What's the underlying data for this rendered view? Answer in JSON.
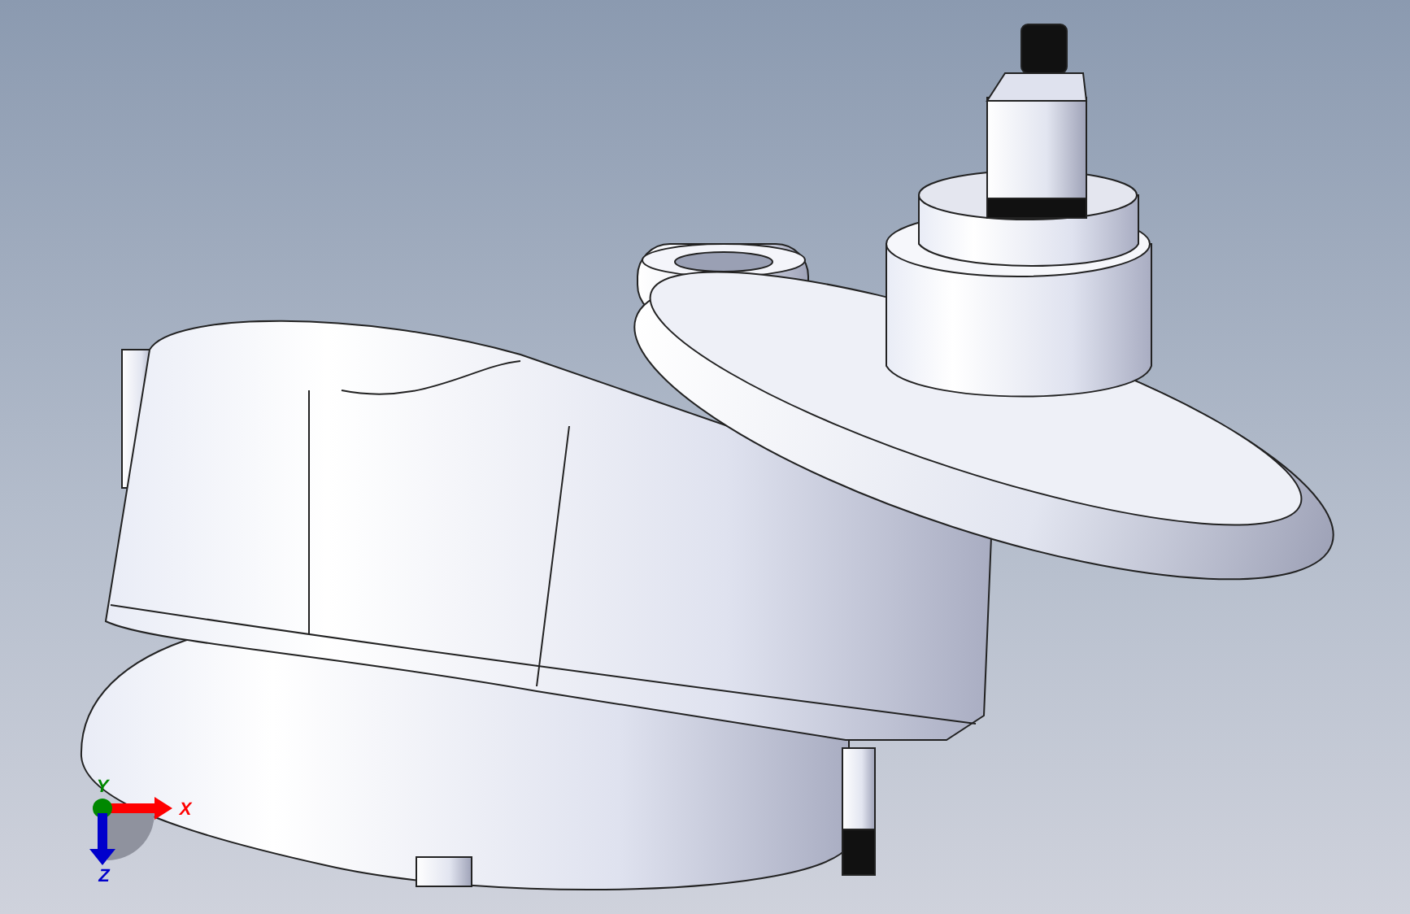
{
  "viewport": {
    "triad": {
      "axes": [
        {
          "kind": "x",
          "label": "X",
          "color": "#ff0000"
        },
        {
          "kind": "y",
          "label": "Y",
          "color": "#008800"
        },
        {
          "kind": "z",
          "label": "Z",
          "color": "#0000cc"
        }
      ]
    }
  }
}
